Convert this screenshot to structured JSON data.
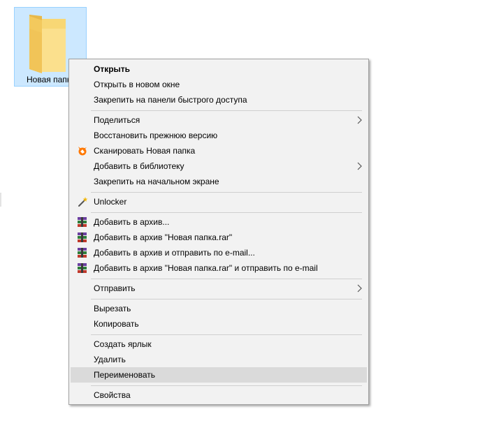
{
  "desktop": {
    "folder_label": "Новая папка"
  },
  "menu": {
    "open": "Открыть",
    "open_new_window": "Открыть в новом окне",
    "pin_quick_access": "Закрепить на панели быстрого доступа",
    "share": "Поделиться",
    "restore_previous": "Восстановить прежнюю версию",
    "scan": "Сканировать Новая папка",
    "add_to_library": "Добавить в библиотеку",
    "pin_start": "Закрепить на начальном экране",
    "unlocker": "Unlocker",
    "add_to_archive": "Добавить в архив...",
    "add_to_rar": "Добавить в архив \"Новая папка.rar\"",
    "add_to_archive_email": "Добавить в архив и отправить по e-mail...",
    "add_to_rar_email": "Добавить в архив \"Новая папка.rar\" и отправить по e-mail",
    "send_to": "Отправить",
    "cut": "Вырезать",
    "copy": "Копировать",
    "create_shortcut": "Создать ярлык",
    "delete": "Удалить",
    "rename": "Переименовать",
    "properties": "Свойства"
  },
  "icons": {
    "folder": "folder-icon",
    "scan": "avast-icon",
    "unlocker": "unlocker-wand-icon",
    "archive": "winrar-icon",
    "submenu": "chevron-right-icon"
  },
  "colors": {
    "selection_bg": "#cce8ff",
    "selection_border": "#99d1ff",
    "menu_bg": "#f2f2f2",
    "hover_bg": "#dadada",
    "avast_orange": "#ff7800"
  }
}
